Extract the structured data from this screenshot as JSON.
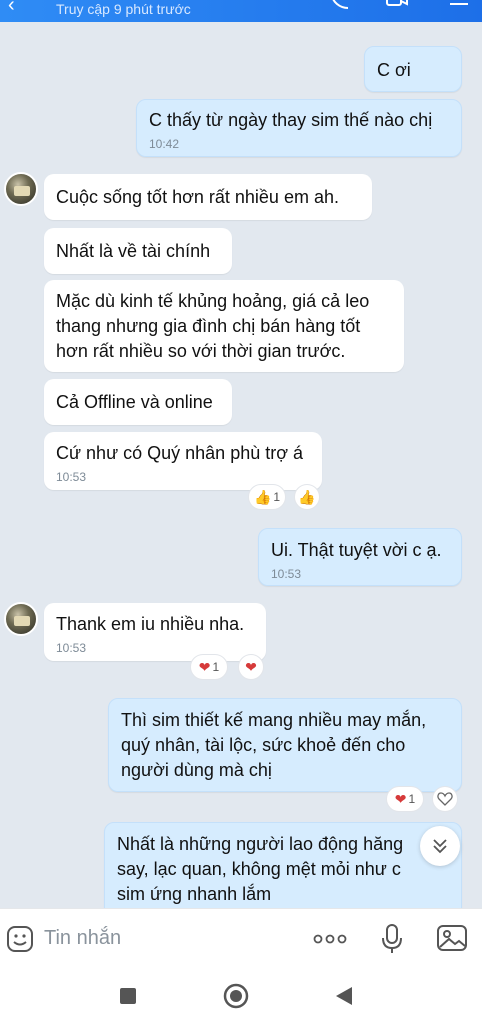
{
  "header": {
    "status": "Truy cập 9 phút trước"
  },
  "messages": [
    {
      "side": "out",
      "text": "C ơi"
    },
    {
      "side": "out",
      "text": "C thấy từ ngày thay sim thế nào chị",
      "time": "10:42"
    },
    {
      "side": "in",
      "text": "Cuộc sống tốt hơn rất nhiều em ah."
    },
    {
      "side": "in",
      "text": "Nhất là về tài chính"
    },
    {
      "side": "in",
      "text": "Mặc dù kinh tế khủng hoảng, giá cả leo\nthang nhưng gia đình chị bán hàng tốt\nhơn rất nhiều so với thời gian trước."
    },
    {
      "side": "in",
      "text": "Cả Offline và online"
    },
    {
      "side": "in",
      "text": "Cứ như có Quý nhân phù trợ á",
      "time": "10:53"
    },
    {
      "side": "out",
      "text": "Ui. Thật tuyệt vời c ạ.",
      "time": "10:53"
    },
    {
      "side": "in",
      "text": "Thank em iu nhiều nha.",
      "time": "10:53"
    },
    {
      "side": "out",
      "text": "Thì sim thiết kế mang nhiều may mắn,\nquý nhân, tài lộc, sức khoẻ đến cho\nngười dùng mà chị"
    },
    {
      "side": "out",
      "text": "Nhất là những người lao động hăng\nsay, lạc quan, không mệt mỏi như c\nsim ứng nhanh lắm"
    }
  ],
  "reactions": {
    "thumbs_count": "1",
    "heart_count_1": "1",
    "heart_count_2": "1",
    "thumbs_icon": "👍",
    "heart_icon": "❤"
  },
  "input": {
    "placeholder": "Tin nhắn"
  },
  "colors": {
    "header": "#1d6fe8",
    "outgoing_bubble": "#d6ecfe",
    "incoming_bubble": "#ffffff",
    "chat_background": "#e2e8ef"
  }
}
